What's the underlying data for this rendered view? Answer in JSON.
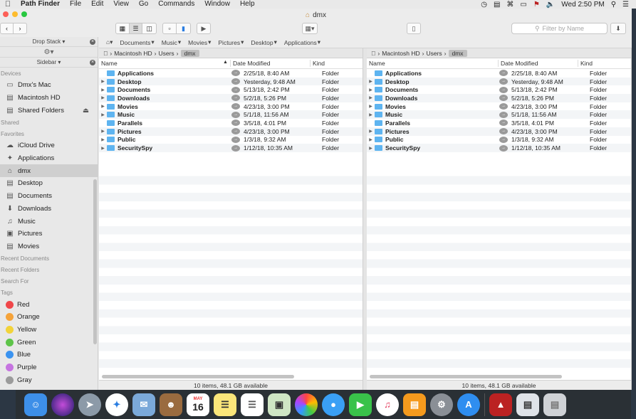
{
  "menubar": {
    "app_name": "Path Finder",
    "menus": [
      "File",
      "Edit",
      "View",
      "Go",
      "Commands",
      "Window",
      "Help"
    ],
    "clock": "Wed 2:50 PM"
  },
  "window": {
    "title": "dmx",
    "search_placeholder": "Filter by Name"
  },
  "sidebar": {
    "drop_stack_label": "Drop Stack",
    "sidebar_label": "Sidebar",
    "sections": {
      "devices": "Devices",
      "shared": "Shared",
      "favorites": "Favorites",
      "recent_documents": "Recent Documents",
      "recent_folders": "Recent Folders",
      "search_for": "Search For",
      "tags": "Tags"
    },
    "devices": [
      "Dmx's Mac",
      "Macintosh HD",
      "Shared Folders"
    ],
    "favorites": [
      "iCloud Drive",
      "Applications",
      "dmx",
      "Desktop",
      "Documents",
      "Downloads",
      "Music",
      "Pictures",
      "Movies"
    ],
    "tags": [
      {
        "name": "Red",
        "color": "#f0474a"
      },
      {
        "name": "Orange",
        "color": "#f5a33a"
      },
      {
        "name": "Yellow",
        "color": "#f2d33a"
      },
      {
        "name": "Green",
        "color": "#5ec449"
      },
      {
        "name": "Blue",
        "color": "#3b93f0"
      },
      {
        "name": "Purple",
        "color": "#c674e0"
      },
      {
        "name": "Gray",
        "color": "#9b9b9b"
      }
    ]
  },
  "pathbar": [
    "Documents",
    "Music",
    "Movies",
    "Pictures",
    "Desktop",
    "Applications"
  ],
  "left_pane": {
    "breadcrumb": [
      "Macintosh HD",
      "Users",
      "dmx"
    ],
    "columns": {
      "name": "Name",
      "date": "Date Modified",
      "kind": "Kind"
    },
    "status": "10 items, 48.1 GB available"
  },
  "right_pane": {
    "breadcrumb": [
      "Macintosh HD",
      "Users",
      "dmx"
    ],
    "columns": {
      "name": "Name",
      "date": "Date Modified",
      "kind": "Kind"
    },
    "status": "10 items, 48.1 GB available"
  },
  "files": [
    {
      "name": "Applications",
      "date": "2/25/18, 8:40 AM",
      "kind": "Folder",
      "expandable": false
    },
    {
      "name": "Desktop",
      "date": "Yesterday, 9:48 AM",
      "kind": "Folder",
      "expandable": true
    },
    {
      "name": "Documents",
      "date": "5/13/18, 2:42 PM",
      "kind": "Folder",
      "expandable": true
    },
    {
      "name": "Downloads",
      "date": "5/2/18, 5:26 PM",
      "kind": "Folder",
      "expandable": true
    },
    {
      "name": "Movies",
      "date": "4/23/18, 3:00 PM",
      "kind": "Folder",
      "expandable": true
    },
    {
      "name": "Music",
      "date": "5/1/18, 11:56 AM",
      "kind": "Folder",
      "expandable": true
    },
    {
      "name": "Parallels",
      "date": "3/5/18, 4:01 PM",
      "kind": "Folder",
      "expandable": false
    },
    {
      "name": "Pictures",
      "date": "4/23/18, 3:00 PM",
      "kind": "Folder",
      "expandable": true
    },
    {
      "name": "Public",
      "date": "1/3/18, 9:32 AM",
      "kind": "Folder",
      "expandable": true
    },
    {
      "name": "SecuritySpy",
      "date": "1/12/18, 10:35 AM",
      "kind": "Folder",
      "expandable": true
    }
  ],
  "dock": {
    "calendar_month": "MAY",
    "calendar_day": "16"
  }
}
